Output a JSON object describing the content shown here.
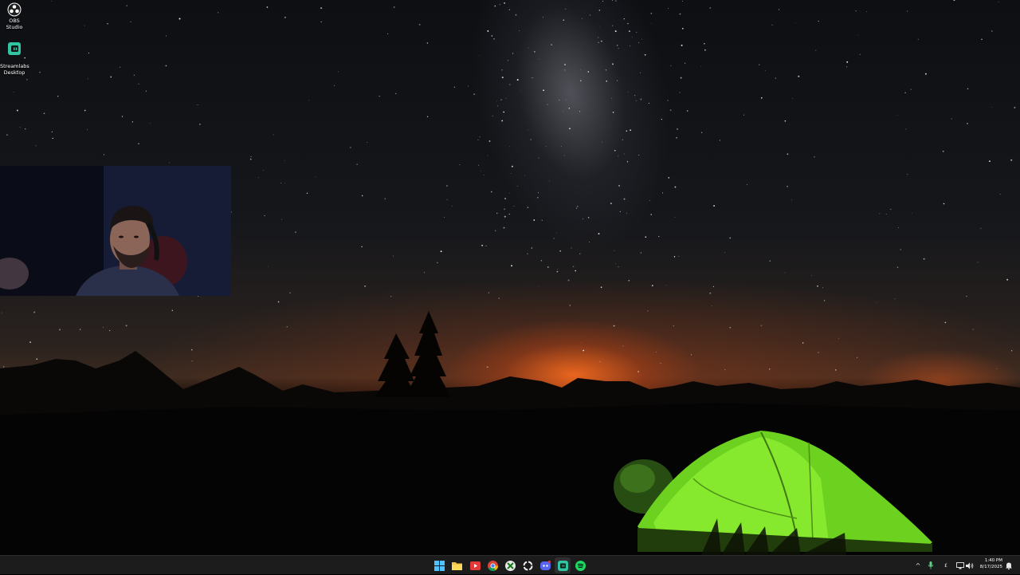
{
  "desktop": {
    "icons": [
      {
        "name": "obs-studio-icon",
        "label": "OBS Studio"
      },
      {
        "name": "streamlabs-desktop-icon",
        "label": "Streamlabs\nDesktop"
      }
    ]
  },
  "taskbar": {
    "apps": [
      {
        "name": "start-icon"
      },
      {
        "name": "file-explorer-icon"
      },
      {
        "name": "media-player-icon"
      },
      {
        "name": "chrome-icon"
      },
      {
        "name": "xbox-icon"
      },
      {
        "name": "circle-app-icon"
      },
      {
        "name": "discord-icon"
      },
      {
        "name": "streamlabs-icon"
      },
      {
        "name": "spotify-icon"
      }
    ],
    "tray": {
      "chevron": "^",
      "language": "£",
      "time": "1:40 PM",
      "date": "8/17/2025"
    }
  },
  "colors": {
    "taskbar_bg": "#1c1c1c",
    "tent_green": "#7fe62a",
    "horizon_orange": "#ff6e1e"
  }
}
